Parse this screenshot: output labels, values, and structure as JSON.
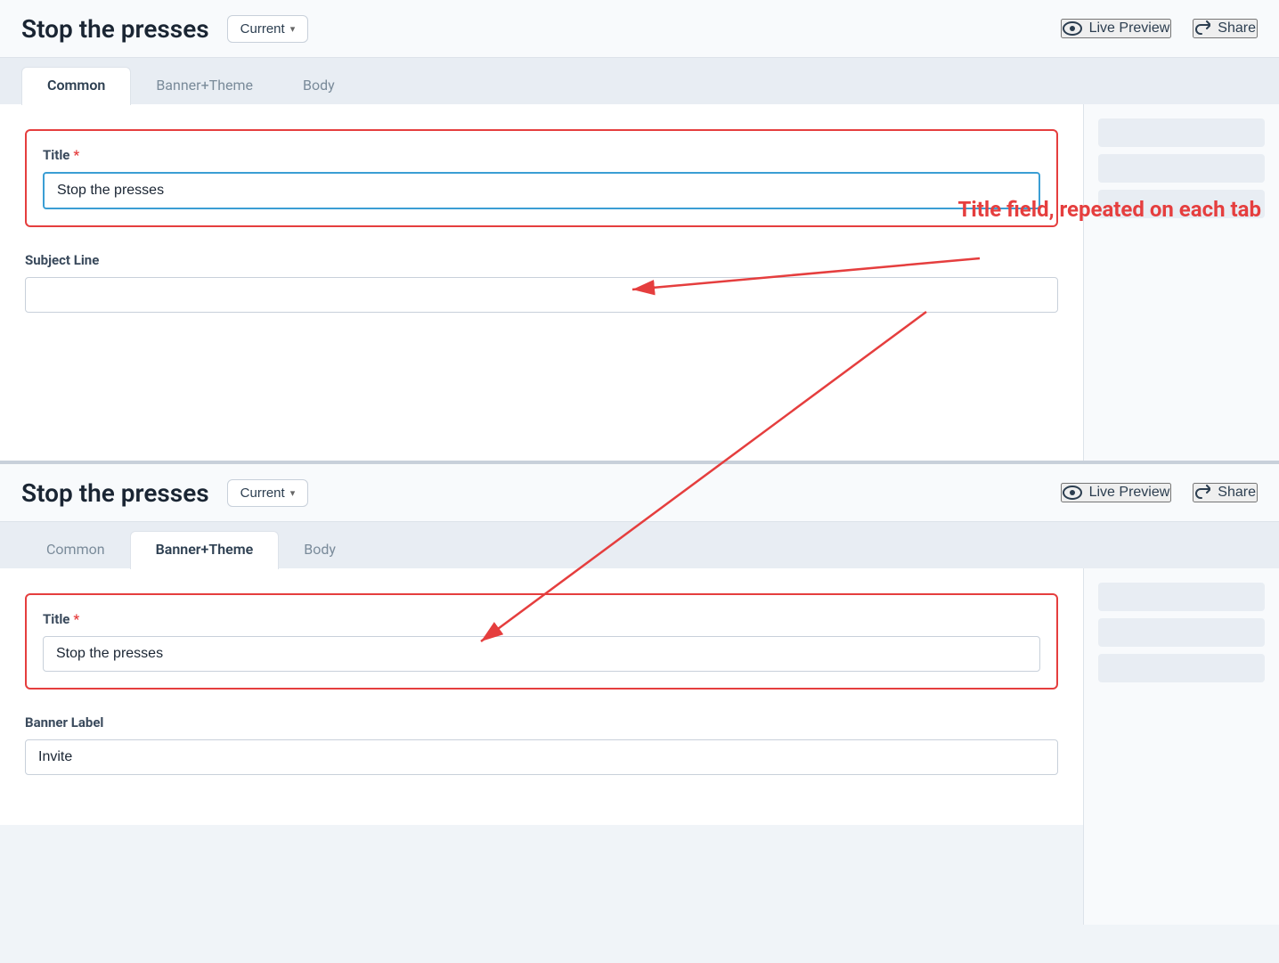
{
  "page": {
    "title": "Stop the presses"
  },
  "header": {
    "title": "Stop the presses",
    "version_label": "Current",
    "version_chevron": "▾",
    "live_preview_label": "Live Preview",
    "share_label": "Share"
  },
  "tabs": {
    "top_panel": [
      {
        "id": "common",
        "label": "Common",
        "active": true
      },
      {
        "id": "banner-theme",
        "label": "Banner+Theme",
        "active": false
      },
      {
        "id": "body",
        "label": "Body",
        "active": false
      }
    ],
    "bottom_panel": [
      {
        "id": "common2",
        "label": "Common",
        "active": false
      },
      {
        "id": "banner-theme2",
        "label": "Banner+Theme",
        "active": true
      },
      {
        "id": "body2",
        "label": "Body",
        "active": false
      }
    ]
  },
  "top_form": {
    "title_label": "Title",
    "title_required": "*",
    "title_value": "Stop the presses",
    "subject_line_label": "Subject Line",
    "subject_line_value": ""
  },
  "bottom_form": {
    "title_label": "Title",
    "title_required": "*",
    "title_value": "Stop the presses",
    "banner_label_label": "Banner Label",
    "banner_label_value": "Invite"
  },
  "annotation": {
    "text": "Title field, repeated on each tab"
  }
}
